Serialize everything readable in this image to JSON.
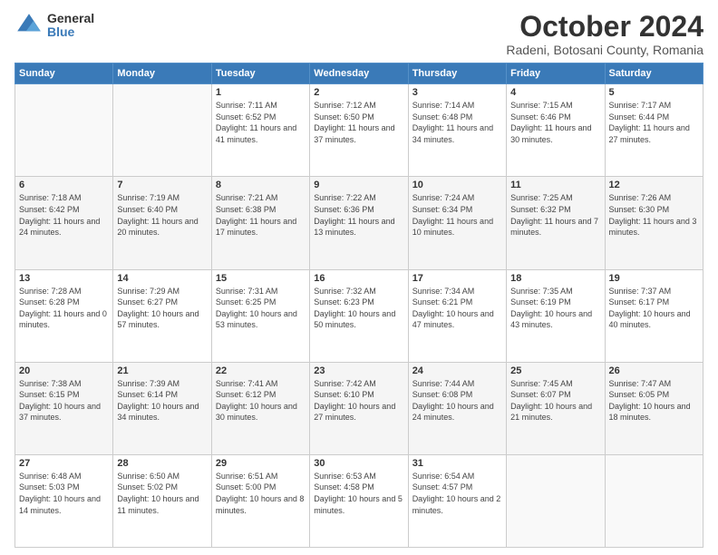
{
  "logo": {
    "general": "General",
    "blue": "Blue"
  },
  "header": {
    "month": "October 2024",
    "location": "Radeni, Botosani County, Romania"
  },
  "weekdays": [
    "Sunday",
    "Monday",
    "Tuesday",
    "Wednesday",
    "Thursday",
    "Friday",
    "Saturday"
  ],
  "weeks": [
    [
      {
        "day": "",
        "info": ""
      },
      {
        "day": "",
        "info": ""
      },
      {
        "day": "1",
        "info": "Sunrise: 7:11 AM\nSunset: 6:52 PM\nDaylight: 11 hours and 41 minutes."
      },
      {
        "day": "2",
        "info": "Sunrise: 7:12 AM\nSunset: 6:50 PM\nDaylight: 11 hours and 37 minutes."
      },
      {
        "day": "3",
        "info": "Sunrise: 7:14 AM\nSunset: 6:48 PM\nDaylight: 11 hours and 34 minutes."
      },
      {
        "day": "4",
        "info": "Sunrise: 7:15 AM\nSunset: 6:46 PM\nDaylight: 11 hours and 30 minutes."
      },
      {
        "day": "5",
        "info": "Sunrise: 7:17 AM\nSunset: 6:44 PM\nDaylight: 11 hours and 27 minutes."
      }
    ],
    [
      {
        "day": "6",
        "info": "Sunrise: 7:18 AM\nSunset: 6:42 PM\nDaylight: 11 hours and 24 minutes."
      },
      {
        "day": "7",
        "info": "Sunrise: 7:19 AM\nSunset: 6:40 PM\nDaylight: 11 hours and 20 minutes."
      },
      {
        "day": "8",
        "info": "Sunrise: 7:21 AM\nSunset: 6:38 PM\nDaylight: 11 hours and 17 minutes."
      },
      {
        "day": "9",
        "info": "Sunrise: 7:22 AM\nSunset: 6:36 PM\nDaylight: 11 hours and 13 minutes."
      },
      {
        "day": "10",
        "info": "Sunrise: 7:24 AM\nSunset: 6:34 PM\nDaylight: 11 hours and 10 minutes."
      },
      {
        "day": "11",
        "info": "Sunrise: 7:25 AM\nSunset: 6:32 PM\nDaylight: 11 hours and 7 minutes."
      },
      {
        "day": "12",
        "info": "Sunrise: 7:26 AM\nSunset: 6:30 PM\nDaylight: 11 hours and 3 minutes."
      }
    ],
    [
      {
        "day": "13",
        "info": "Sunrise: 7:28 AM\nSunset: 6:28 PM\nDaylight: 11 hours and 0 minutes."
      },
      {
        "day": "14",
        "info": "Sunrise: 7:29 AM\nSunset: 6:27 PM\nDaylight: 10 hours and 57 minutes."
      },
      {
        "day": "15",
        "info": "Sunrise: 7:31 AM\nSunset: 6:25 PM\nDaylight: 10 hours and 53 minutes."
      },
      {
        "day": "16",
        "info": "Sunrise: 7:32 AM\nSunset: 6:23 PM\nDaylight: 10 hours and 50 minutes."
      },
      {
        "day": "17",
        "info": "Sunrise: 7:34 AM\nSunset: 6:21 PM\nDaylight: 10 hours and 47 minutes."
      },
      {
        "day": "18",
        "info": "Sunrise: 7:35 AM\nSunset: 6:19 PM\nDaylight: 10 hours and 43 minutes."
      },
      {
        "day": "19",
        "info": "Sunrise: 7:37 AM\nSunset: 6:17 PM\nDaylight: 10 hours and 40 minutes."
      }
    ],
    [
      {
        "day": "20",
        "info": "Sunrise: 7:38 AM\nSunset: 6:15 PM\nDaylight: 10 hours and 37 minutes."
      },
      {
        "day": "21",
        "info": "Sunrise: 7:39 AM\nSunset: 6:14 PM\nDaylight: 10 hours and 34 minutes."
      },
      {
        "day": "22",
        "info": "Sunrise: 7:41 AM\nSunset: 6:12 PM\nDaylight: 10 hours and 30 minutes."
      },
      {
        "day": "23",
        "info": "Sunrise: 7:42 AM\nSunset: 6:10 PM\nDaylight: 10 hours and 27 minutes."
      },
      {
        "day": "24",
        "info": "Sunrise: 7:44 AM\nSunset: 6:08 PM\nDaylight: 10 hours and 24 minutes."
      },
      {
        "day": "25",
        "info": "Sunrise: 7:45 AM\nSunset: 6:07 PM\nDaylight: 10 hours and 21 minutes."
      },
      {
        "day": "26",
        "info": "Sunrise: 7:47 AM\nSunset: 6:05 PM\nDaylight: 10 hours and 18 minutes."
      }
    ],
    [
      {
        "day": "27",
        "info": "Sunrise: 6:48 AM\nSunset: 5:03 PM\nDaylight: 10 hours and 14 minutes."
      },
      {
        "day": "28",
        "info": "Sunrise: 6:50 AM\nSunset: 5:02 PM\nDaylight: 10 hours and 11 minutes."
      },
      {
        "day": "29",
        "info": "Sunrise: 6:51 AM\nSunset: 5:00 PM\nDaylight: 10 hours and 8 minutes."
      },
      {
        "day": "30",
        "info": "Sunrise: 6:53 AM\nSunset: 4:58 PM\nDaylight: 10 hours and 5 minutes."
      },
      {
        "day": "31",
        "info": "Sunrise: 6:54 AM\nSunset: 4:57 PM\nDaylight: 10 hours and 2 minutes."
      },
      {
        "day": "",
        "info": ""
      },
      {
        "day": "",
        "info": ""
      }
    ]
  ]
}
